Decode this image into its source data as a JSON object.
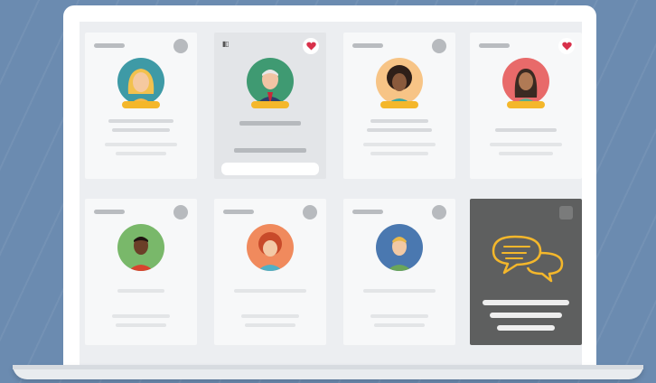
{
  "scene": {
    "background_color": "#6b8bb0",
    "accent_color": "#f4b72b"
  },
  "cards": [
    {
      "name": "card-1",
      "action": "circle-button",
      "avatar_bg": "#3e9aa6",
      "featured": false
    },
    {
      "name": "card-2",
      "action": "heart-button",
      "avatar_bg": "#3f9a72",
      "featured": true,
      "corner_icon": "▮▯"
    },
    {
      "name": "card-3",
      "action": "circle-button",
      "avatar_bg": "#f7c486",
      "featured": false
    },
    {
      "name": "card-4",
      "action": "heart-button",
      "avatar_bg": "#e86a6a",
      "featured": false
    },
    {
      "name": "card-5",
      "action": "circle-button",
      "avatar_bg": "#79b86a",
      "featured": false
    },
    {
      "name": "card-6",
      "action": "circle-button",
      "avatar_bg": "#f08a5d",
      "featured": false
    },
    {
      "name": "card-7",
      "action": "circle-button",
      "avatar_bg": "#4a78b0",
      "featured": false
    }
  ],
  "message_card": {
    "icon": "chat-bubbles-icon",
    "bg_color": "#5e5f5f"
  },
  "icons": {
    "heart": "heart-icon",
    "favorite_color": "#d8304a"
  }
}
